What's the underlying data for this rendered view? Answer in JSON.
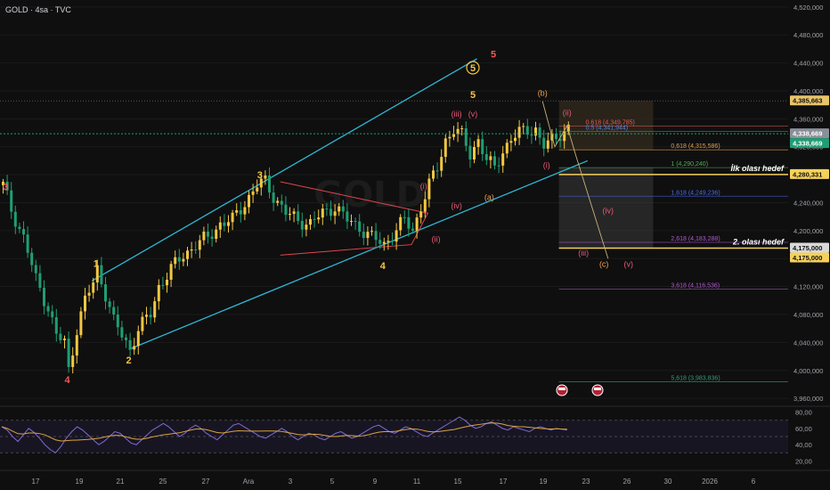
{
  "header": {
    "title": "GOLD · 4sa · TVC"
  },
  "watermark": "GOLD",
  "colors": {
    "background": "#0f0f0f",
    "up": "#f2c744",
    "down": "#1f9e74",
    "channel": "#2fb7d6",
    "triangle": "#e0454f",
    "wave_red": "#f05a5a",
    "wave_yellow": "#f5c542",
    "wave_orange": "#f0a050",
    "wave_pink": "#e85a7a",
    "target_line": "#f5d15b",
    "rsi_line": "#7e6bd6",
    "rsi_ma": "#d9a53d"
  },
  "chart_data": {
    "type": "candlestick",
    "symbol": "GOLD",
    "timeframe": "4sa",
    "source": "TVC",
    "x_tick_labels": [
      "17",
      "19",
      "21",
      "25",
      "27",
      "Ara",
      "3",
      "5",
      "9",
      "11",
      "15",
      "17",
      "19",
      "23",
      "26",
      "30",
      "2026",
      "6"
    ],
    "y_tick_labels": [
      "4,520,000",
      "4,480,000",
      "4,440,000",
      "4,400,000",
      "4,360,000",
      "4,320,000",
      "4,280,000",
      "4,240,000",
      "4,200,000",
      "4,160,000",
      "4,120,000",
      "4,080,000",
      "4,040,000",
      "4,000,000",
      "3,960,000"
    ],
    "ylim": [
      3950,
      4530
    ],
    "price_badges": [
      {
        "label": "4,385,663",
        "value": 4385.663,
        "color": "#e8c46a"
      },
      {
        "label": "4,338,669",
        "value": 4338.669,
        "color": "#8a8f98"
      },
      {
        "label": "4,338,669",
        "value": 4338.669,
        "color": "#1f9e74"
      },
      {
        "label": "4,280,331",
        "value": 4280.331,
        "color": "#f5d15b"
      },
      {
        "label": "4,175,000",
        "value": 4175.0,
        "color": "#d9d9d9"
      },
      {
        "label": "4,175,000",
        "value": 4175.0,
        "color": "#f5d15b"
      }
    ],
    "fib_levels": [
      {
        "label": "0.618 (4,349,785)",
        "value": 4349.785,
        "color": "#e85a5a"
      },
      {
        "label": "0.5 (4,341,944)",
        "value": 4341.944,
        "color": "#4a8ae8"
      },
      {
        "label": "0,618 (4,315,586)",
        "value": 4315.586,
        "color": "#e0a050"
      },
      {
        "label": "1 (4,290,240)",
        "value": 4290.24,
        "color": "#4caf50"
      },
      {
        "label": "1,618 (4,249,236)",
        "value": 4249.236,
        "color": "#4a6ae8"
      },
      {
        "label": "2,618 (4,183,288)",
        "value": 4183.288,
        "color": "#b05ad0"
      },
      {
        "label": "3,618 (4,116,536)",
        "value": 4116.536,
        "color": "#b05ad0"
      },
      {
        "label": "5,618 (3,983,836)",
        "value": 3983.836,
        "color": "#2e9e74"
      }
    ],
    "targets": [
      {
        "label": "İlk olası hedef",
        "value": 4280.331
      },
      {
        "label": "2. olası hedef",
        "value": 4175.0
      }
    ],
    "wave_labels": [
      {
        "text": "3",
        "group": "red",
        "x": 1,
        "y": 4258
      },
      {
        "text": "4",
        "group": "red",
        "x": 16,
        "y": 3982
      },
      {
        "text": "1",
        "group": "yellow",
        "x": 23,
        "y": 4148
      },
      {
        "text": "2",
        "group": "yellow",
        "x": 31,
        "y": 4010
      },
      {
        "text": "3",
        "group": "yellow",
        "x": 63,
        "y": 4275
      },
      {
        "text": "4",
        "group": "yellow",
        "x": 93,
        "y": 4145
      },
      {
        "text": "5",
        "group": "yellow",
        "x": 115,
        "y": 4390
      },
      {
        "text": "5",
        "group": "red",
        "x": 120,
        "y": 4448
      },
      {
        "text": "(iii)",
        "group": "pink",
        "x": 111,
        "y": 4363
      },
      {
        "text": "(v)",
        "group": "pink",
        "x": 115,
        "y": 4363
      },
      {
        "text": "(i)",
        "group": "pink",
        "x": 103,
        "y": 4260
      },
      {
        "text": "(iv)",
        "group": "pink",
        "x": 111,
        "y": 4232
      },
      {
        "text": "(ii)",
        "group": "pink",
        "x": 106,
        "y": 4184
      },
      {
        "text": "(a)",
        "group": "orange",
        "x": 119,
        "y": 4244
      },
      {
        "text": "(b)",
        "group": "orange",
        "x": 132,
        "y": 4393
      },
      {
        "text": "(ii)",
        "group": "pink",
        "x": 138,
        "y": 4365
      },
      {
        "text": "(i)",
        "group": "pink",
        "x": 133,
        "y": 4290
      },
      {
        "text": "(iv)",
        "group": "pink",
        "x": 148,
        "y": 4225
      },
      {
        "text": "(iii)",
        "group": "pink",
        "x": 142,
        "y": 4164
      },
      {
        "text": "(c)",
        "group": "orange",
        "x": 147,
        "y": 4148
      },
      {
        "text": "(v)",
        "group": "pink",
        "x": 153,
        "y": 4148
      }
    ],
    "circled_label": {
      "text": "5",
      "x": 115,
      "y": 4428
    },
    "rsi": {
      "tick_labels": [
        "80,00",
        "60,00",
        "40,00",
        "20,00"
      ],
      "ylim": [
        15,
        85
      ],
      "values": [
        62,
        58,
        50,
        44,
        52,
        60,
        55,
        48,
        40,
        34,
        30,
        38,
        48,
        56,
        62,
        58,
        52,
        46,
        40,
        44,
        50,
        56,
        54,
        48,
        42,
        40,
        46,
        52,
        58,
        62,
        66,
        62,
        56,
        50,
        54,
        60,
        64,
        60,
        54,
        50,
        46,
        52,
        58,
        64,
        66,
        62,
        58,
        54,
        50,
        48,
        52,
        56,
        60,
        56,
        50,
        46,
        50,
        54,
        52,
        48,
        46,
        50,
        54,
        56,
        52,
        48,
        50,
        54,
        58,
        62,
        64,
        60,
        56,
        54,
        58,
        62,
        60,
        56,
        52,
        50,
        54,
        58,
        62,
        66,
        70,
        74,
        70,
        64,
        60,
        62,
        66,
        68,
        64,
        60,
        58,
        62,
        60,
        58,
        56,
        60,
        62,
        60,
        58,
        60,
        59,
        58
      ]
    }
  }
}
